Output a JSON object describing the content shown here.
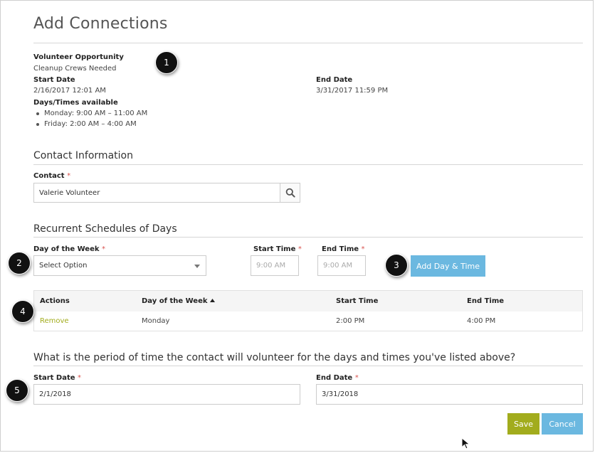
{
  "page": {
    "title": "Add Connections"
  },
  "opportunity": {
    "label": "Volunteer Opportunity",
    "value": "Cleanup Crews Needed",
    "start_label": "Start Date",
    "start_value": "2/16/2017 12:01 AM",
    "end_label": "End Date",
    "end_value": "3/31/2017 11:59 PM",
    "days_label": "Days/Times available",
    "days": [
      "Monday: 9:00 AM – 11:00 AM",
      "Friday: 2:00 AM – 4:00 AM"
    ]
  },
  "contact_section": {
    "heading": "Contact Information",
    "contact_label": "Contact",
    "required_mark": "*",
    "contact_value": "Valerie Volunteer",
    "search_icon": "search-icon"
  },
  "schedule_section": {
    "heading": "Recurrent Schedules of Days",
    "day_label": "Day of the Week",
    "day_selected": "Select Option",
    "dropdown_icon": "caret-down-icon",
    "start_time_label": "Start Time",
    "start_time_placeholder": "9:00 AM",
    "end_time_label": "End Time",
    "end_time_placeholder": "9:00 AM",
    "add_button": "Add Day & Time"
  },
  "table": {
    "headers": [
      "Actions",
      "Day of the Week",
      "Start Time",
      "End Time"
    ],
    "sort_icon": "sort-up-icon",
    "rows": [
      {
        "action": "Remove",
        "day": "Monday",
        "start": "2:00 PM",
        "end": "4:00 PM"
      }
    ]
  },
  "period_section": {
    "question": "What is the period of time the contact will volunteer for the days and times you've listed above?",
    "start_label": "Start Date",
    "start_value": "2/1/2018",
    "end_label": "End Date",
    "end_value": "3/31/2018"
  },
  "actions": {
    "save": "Save",
    "cancel": "Cancel"
  },
  "badges": [
    "1",
    "2",
    "3",
    "4",
    "5"
  ],
  "colors": {
    "save": "#a2ac1d",
    "cancel": "#6bb8e0",
    "add": "#6bb8e0",
    "remove_link": "#a2ac1d",
    "required": "#d9534f"
  }
}
